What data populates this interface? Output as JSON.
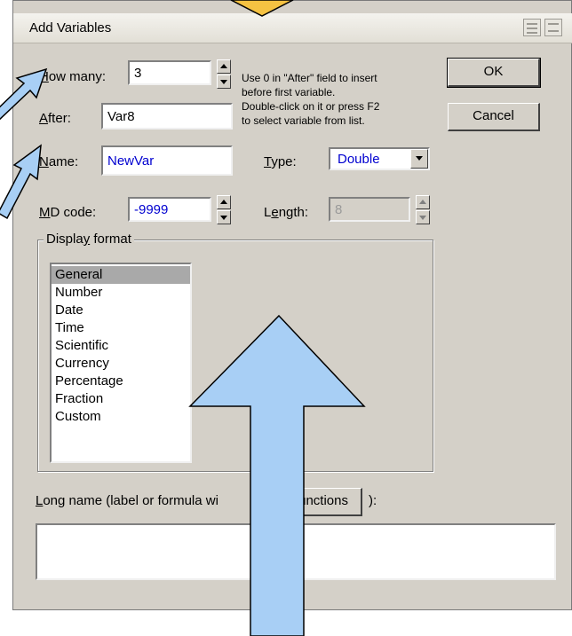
{
  "window": {
    "title": "Add Variables"
  },
  "form": {
    "how_many_label_first": "H",
    "how_many_label_rest": "ow many:",
    "how_many_value": "3",
    "after_label_first": "A",
    "after_label_rest": "fter:",
    "after_value": "Var8",
    "name_label_first": "N",
    "name_label_rest": "ame:",
    "name_value": "NewVar",
    "md_code_label_first": "M",
    "md_code_label_rest": "D code:",
    "md_code_value": "-9999",
    "type_label_first": "T",
    "type_label_rest": "ype:",
    "type_value": "Double",
    "length_label_pre": "L",
    "length_label_ul": "e",
    "length_label_rest": "ngth:",
    "length_value": "8",
    "hint_lines": [
      "Use 0 in \"After\" field to insert",
      "before first variable.",
      "Double-click on it or press F2",
      "to select variable from list."
    ]
  },
  "buttons": {
    "ok": "OK",
    "cancel": "Cancel",
    "functions": "unctions"
  },
  "display_format": {
    "title_pre": "Displa",
    "title_ul": "y",
    "title_post": " format",
    "items": [
      "General",
      "Number",
      "Date",
      "Time",
      "Scientific",
      "Currency",
      "Percentage",
      "Fraction",
      "Custom"
    ],
    "selected": "General"
  },
  "long_name": {
    "label_first": "L",
    "label_rest": "ong name (label or formula wi",
    "close_paren": "):"
  },
  "colors": {
    "arrow_fill": "#a8cff5",
    "arrow_stroke": "#000000",
    "top_marker": "#f5c242"
  }
}
